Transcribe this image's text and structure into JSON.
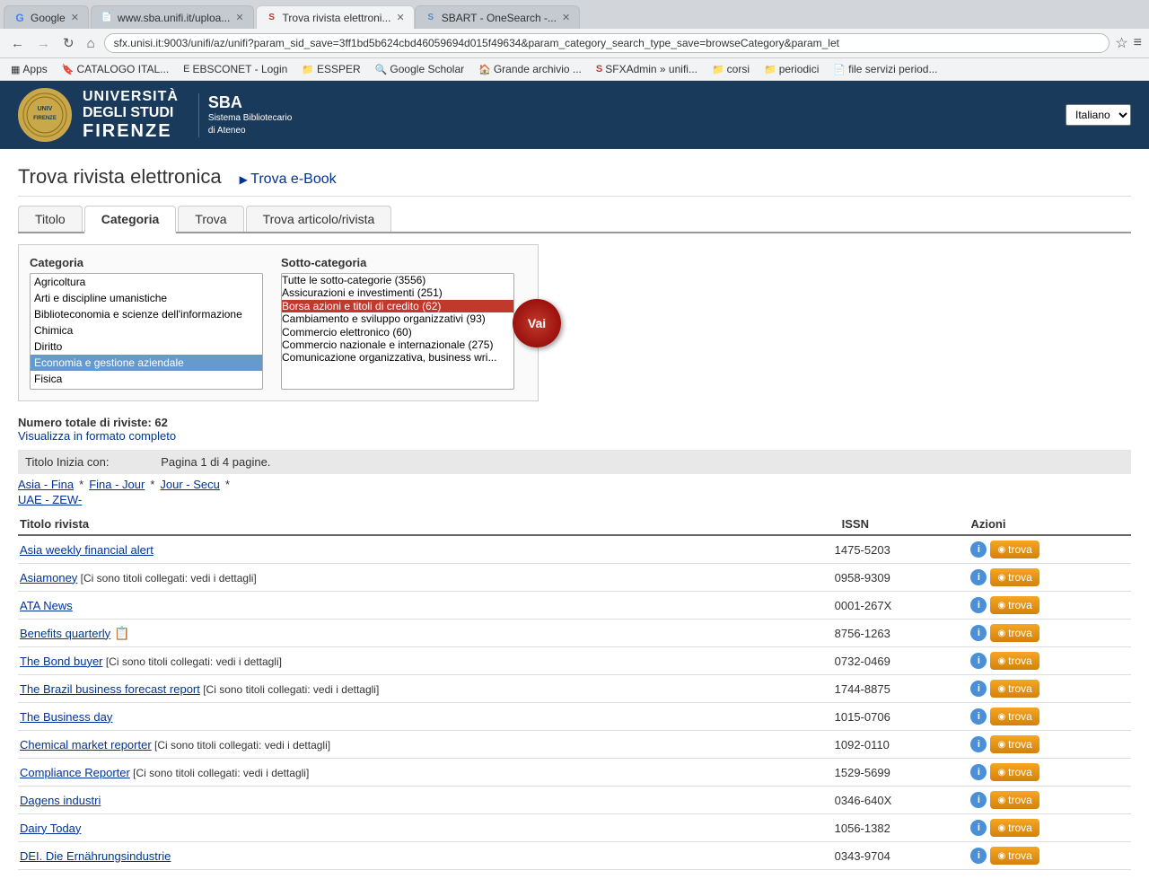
{
  "browser": {
    "tabs": [
      {
        "id": "tab1",
        "label": "Google",
        "favicon": "G",
        "active": false
      },
      {
        "id": "tab2",
        "label": "www.sba.unifi.it/uploa...",
        "favicon": "📄",
        "active": false
      },
      {
        "id": "tab3",
        "label": "Trova rivista elettroni...",
        "favicon": "S",
        "active": true
      },
      {
        "id": "tab4",
        "label": "SBART - OneSearch -...",
        "favicon": "S",
        "active": false
      }
    ],
    "url": "sfx.unisi.it:9003/unifi/az/unifi?param_sid_save=3ff1bd5b624cbd46059694d015f49634&param_category_search_type_save=browseCategory&param_let",
    "bookmarks": [
      {
        "label": "Apps",
        "icon": "▦"
      },
      {
        "label": "CATALOGO ITAL...",
        "icon": "🔖"
      },
      {
        "label": "EBSCONET - Login",
        "icon": "E"
      },
      {
        "label": "ESSPER",
        "icon": "📁"
      },
      {
        "label": "Google Scholar",
        "icon": "🔍"
      },
      {
        "label": "Grande archivio ...",
        "icon": "🏠"
      },
      {
        "label": "SFXAdmin » unifi...",
        "icon": "S"
      },
      {
        "label": "corsi",
        "icon": "📁"
      },
      {
        "label": "periodici",
        "icon": "📁"
      },
      {
        "label": "file servizi period...",
        "icon": "📄"
      }
    ]
  },
  "uni_header": {
    "university_name_line1": "UNIVERSITÀ",
    "university_name_line2": "DEGLI STUDI",
    "university_name_line3": "FIRENZE",
    "sba_title": "SBA",
    "sba_subtitle": "Sistema Bibliotecario\ndi Ateneo",
    "language_options": [
      "Italiano"
    ],
    "language_selected": "Italiano"
  },
  "page": {
    "main_title": "Trova rivista elettronica",
    "ebook_link_label": "Trova e-Book",
    "tabs": [
      {
        "id": "titolo",
        "label": "Titolo",
        "active": false
      },
      {
        "id": "categoria",
        "label": "Categoria",
        "active": true
      },
      {
        "id": "trova",
        "label": "Trova",
        "active": false
      },
      {
        "id": "articolo",
        "label": "Trova articolo/rivista",
        "active": false
      }
    ]
  },
  "category_panel": {
    "categoria_label": "Categoria",
    "sotto_categoria_label": "Sotto-categoria",
    "categories": [
      "Agricoltura",
      "Arti e discipline umanistiche",
      "Biblioteconomia e scienze dell'informazione",
      "Chimica",
      "Diritto",
      "Economia e gestione aziendale",
      "Fisica"
    ],
    "selected_category": "Economia e gestione aziendale",
    "subcategories": [
      "Tutte le sotto-categorie (3556)",
      "Assicurazioni e investimenti (251)",
      "Borsa azioni e titoli di credito (62)",
      "Cambiamento e sviluppo organizzativi (93)",
      "Commercio elettronico (60)",
      "Commercio nazionale e internazionale (275)",
      "Comunicazione organizzativa, business wri..."
    ],
    "selected_subcategory": "Borsa azioni e titoli di credito (62)",
    "vai_label": "Vai"
  },
  "results": {
    "total_label": "Numero totale di riviste: 62",
    "view_full_label": "Visualizza in formato completo",
    "pagination_label": "Titolo Inizia con:",
    "page_info": "Pagina 1 di 4 pagine.",
    "page_links": [
      {
        "label": "Asia - Fina",
        "range": "Asia - Fina"
      },
      {
        "label": "Fina - Jour",
        "range": "Fina - Jour"
      },
      {
        "label": "Jour - Secu",
        "range": "Jour - Secu"
      },
      {
        "label": "UAE - ZEW-",
        "range": "UAE - ZEW-"
      }
    ],
    "col_headers": {
      "titolo": "Titolo rivista",
      "issn": "ISSN",
      "azioni": "Azioni"
    },
    "journals": [
      {
        "title": "Asia weekly financial alert",
        "note": "",
        "has_linked": false,
        "has_icon": false,
        "issn": "1475-5203",
        "trova_label": "trova"
      },
      {
        "title": "Asiamoney",
        "note": "  [Ci sono titoli collegati: vedi i dettagli]",
        "has_linked": true,
        "has_icon": false,
        "issn": "0958-9309",
        "trova_label": "trova"
      },
      {
        "title": "ATA News",
        "note": "",
        "has_linked": false,
        "has_icon": false,
        "issn": "0001-267X",
        "trova_label": "trova"
      },
      {
        "title": "Benefits quarterly",
        "note": "",
        "has_linked": false,
        "has_icon": true,
        "issn": "8756-1263",
        "trova_label": "trova"
      },
      {
        "title": "The Bond buyer",
        "note": "  [Ci sono titoli collegati: vedi i dettagli]",
        "has_linked": true,
        "has_icon": false,
        "issn": "0732-0469",
        "trova_label": "trova"
      },
      {
        "title": "The Brazil business forecast report",
        "note": "  [Ci sono titoli collegati: vedi i dettagli]",
        "has_linked": true,
        "has_icon": false,
        "issn": "1744-8875",
        "trova_label": "trova"
      },
      {
        "title": "The Business day",
        "note": "",
        "has_linked": false,
        "has_icon": false,
        "issn": "1015-0706",
        "trova_label": "trova"
      },
      {
        "title": "Chemical market reporter",
        "note": "  [Ci sono titoli collegati: vedi i dettagli]",
        "has_linked": true,
        "has_icon": false,
        "issn": "1092-0110",
        "trova_label": "trova"
      },
      {
        "title": "Compliance Reporter",
        "note": "  [Ci sono titoli collegati: vedi i dettagli]",
        "has_linked": true,
        "has_icon": false,
        "issn": "1529-5699",
        "trova_label": "trova"
      },
      {
        "title": "Dagens industri",
        "note": "",
        "has_linked": false,
        "has_icon": false,
        "issn": "0346-640X",
        "trova_label": "trova"
      },
      {
        "title": "Dairy Today",
        "note": "",
        "has_linked": false,
        "has_icon": false,
        "issn": "1056-1382",
        "trova_label": "trova"
      },
      {
        "title": "DEI. Die Ernährungsindustrie",
        "note": "",
        "has_linked": false,
        "has_icon": false,
        "issn": "0343-9704",
        "trova_label": "trova"
      }
    ]
  }
}
